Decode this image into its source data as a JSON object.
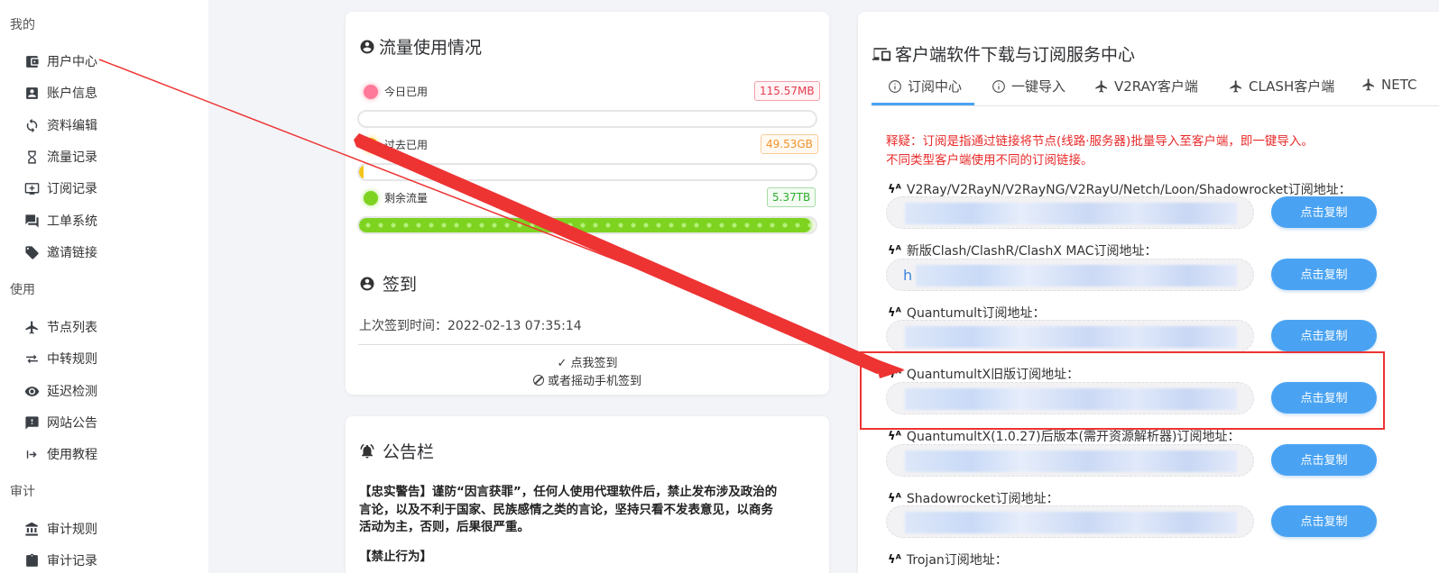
{
  "sidebar": {
    "sections": [
      {
        "title": "我的",
        "items": [
          {
            "label": "用户中心",
            "icon": "wallet-icon"
          },
          {
            "label": "账户信息",
            "icon": "account-box-icon"
          },
          {
            "label": "资料编辑",
            "icon": "sync-icon"
          },
          {
            "label": "流量记录",
            "icon": "hourglass-icon"
          },
          {
            "label": "订阅记录",
            "icon": "monitor-add-icon"
          },
          {
            "label": "工单系统",
            "icon": "chat-icon"
          },
          {
            "label": "邀请链接",
            "icon": "tag-icon"
          }
        ]
      },
      {
        "title": "使用",
        "items": [
          {
            "label": "节点列表",
            "icon": "airplane-icon"
          },
          {
            "label": "中转规则",
            "icon": "transfer-icon"
          },
          {
            "label": "延迟检测",
            "icon": "eye-icon"
          },
          {
            "label": "网站公告",
            "icon": "alert-box-icon"
          },
          {
            "label": "使用教程",
            "icon": "arrow-right-bar-icon"
          }
        ]
      },
      {
        "title": "审计",
        "items": [
          {
            "label": "审计规则",
            "icon": "bank-icon"
          },
          {
            "label": "审计记录",
            "icon": "clipboard-icon"
          }
        ]
      }
    ]
  },
  "traffic": {
    "title": "流量使用情况",
    "rows": [
      {
        "label": "今日已用",
        "value": "115.57MB",
        "color": "#ff6b8f",
        "badge_color": "#e53b4f",
        "fill_fraction": 0.0,
        "bar_color": "#ff6b8f"
      },
      {
        "label": "过去已用",
        "value": "49.53GB",
        "color": "#f5c518",
        "badge_color": "#f0932b",
        "fill_fraction": 0.01,
        "bar_color": "#f5c518"
      },
      {
        "label": "剩余流量",
        "value": "5.37TB",
        "color": "#7ed321",
        "badge_color": "#2fae2f",
        "fill_fraction": 0.99,
        "bar_color": "#7ed321"
      }
    ]
  },
  "checkin": {
    "title": "签到",
    "last_time_label": "上次签到时间：2022-02-13 07:35:14",
    "button_label": "✓ 点我签到",
    "shake_label": "或者摇动手机签到"
  },
  "notice": {
    "title": "公告栏",
    "warning": "【忠实警告】谨防“因言获罪”，任何人使用代理软件后，禁止发布涉及政治的言论，以及不利于国家、民族感情之类的言论，坚持只看不发表意见，以商务活动为主，否则，后果很严重。",
    "warning_lines": [
      "【忠实警告】谨防“因言获罪”，任何人使用代理软件后，禁止发布涉及政治的",
      "言论，以及不利于国家、民族感情之类的言论，坚持只看不发表意见，以商务",
      "活动为主，否则，后果很严重。"
    ],
    "forbidden": "【禁止行为】"
  },
  "client": {
    "title": "客户端软件下载与订阅服务中心",
    "tabs": [
      {
        "label": "订阅中心",
        "icon": "info-icon",
        "active": true
      },
      {
        "label": "一键导入",
        "icon": "info-icon",
        "active": false
      },
      {
        "label": "V2RAY客户端",
        "icon": "airplane-icon",
        "active": false
      },
      {
        "label": "CLASH客户端",
        "icon": "airplane-icon",
        "active": false
      },
      {
        "label": "NETC",
        "icon": "airplane-icon",
        "active": false
      }
    ],
    "explain_line1": "释疑：订阅是指通过链接将节点(线路·服务器)批量导入至客户端，即一键导入。",
    "explain_line2": "不同类型客户端使用不同的订阅链接。",
    "copy_label": "点击复制",
    "subscriptions": [
      {
        "label": "V2Ray/V2RayN/V2RayNG/V2RayU/Netch/Loon/Shadowrocket订阅地址：",
        "prefix": ""
      },
      {
        "label": "新版Clash/ClashR/ClashX MAC订阅地址：",
        "prefix": "h"
      },
      {
        "label": "Quantumult订阅地址：",
        "prefix": ""
      },
      {
        "label": "QuantumultX旧版订阅地址：",
        "prefix": ""
      },
      {
        "label": "QuantumultX(1.0.27)后版本(需开资源解析器)订阅地址：",
        "prefix": ""
      },
      {
        "label": "Shadowrocket订阅地址：",
        "prefix": ""
      },
      {
        "label": "Trojan订阅地址：",
        "prefix": ""
      }
    ]
  },
  "colors": {
    "accent": "#4aa3f2",
    "tab_active_border": "#4aa3f2",
    "annotation_red": "#e33"
  }
}
